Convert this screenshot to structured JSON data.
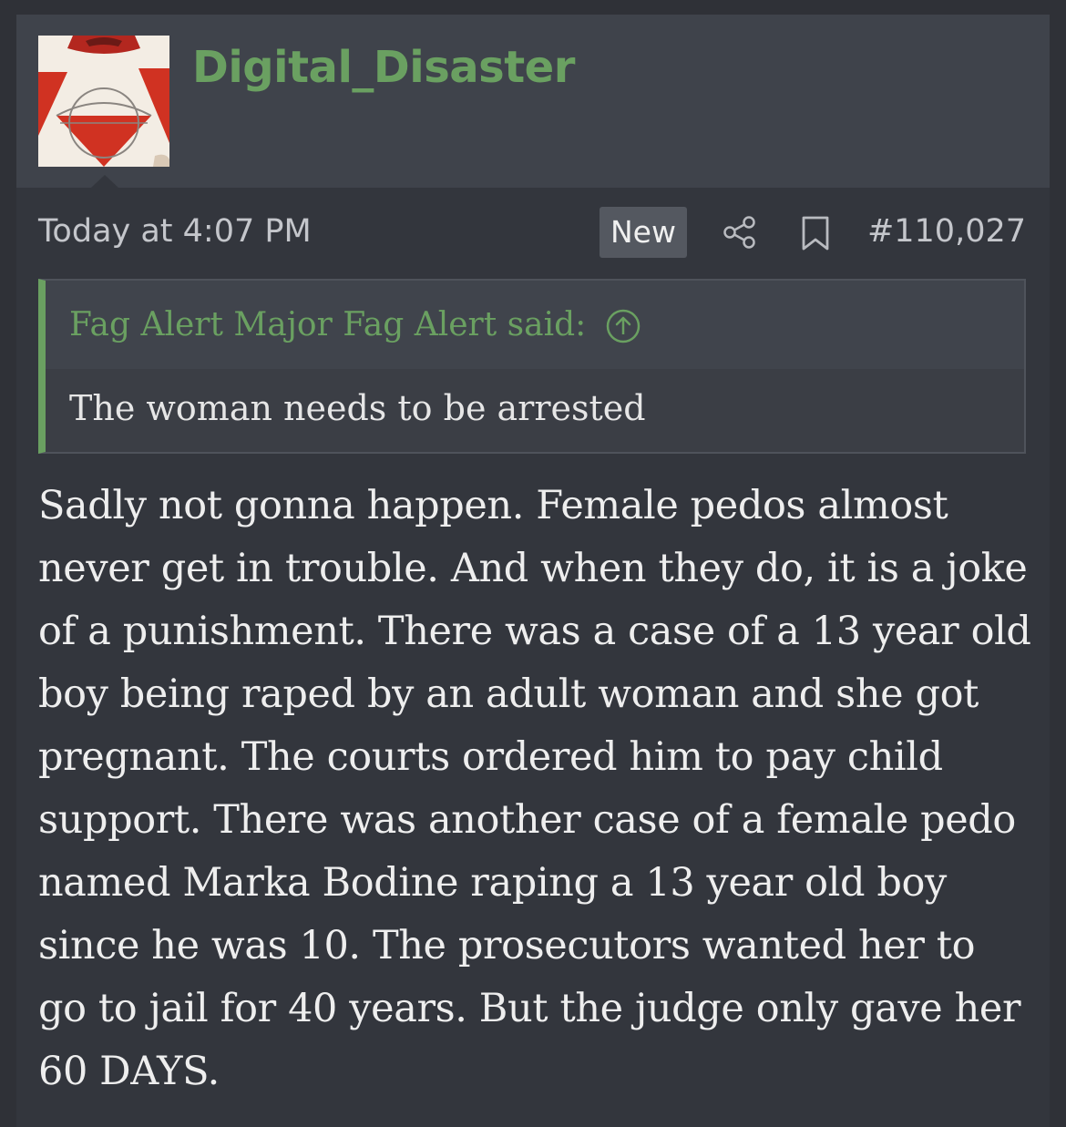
{
  "post": {
    "username": "Digital_Disaster",
    "timestamp": "Today at 4:07 PM",
    "badge": "New",
    "post_number": "#110,027",
    "icons": {
      "share": "share-icon",
      "bookmark": "bookmark-icon",
      "quote_jump": "arrow-up-circle-icon"
    },
    "colors": {
      "username": "#6aa061",
      "quote_accent": "#6aa061"
    }
  },
  "quote": {
    "author": "Fag Alert Major Fag Alert said:",
    "text": "The woman needs to be arrested"
  },
  "message": {
    "text": "Sadly not gonna happen. Female pedos almost never get in trouble. And when they do, it is a joke of a punishment. There was a case of a 13 year old boy being raped by an adult woman and she got pregnant. The courts ordered him to pay child support. There was another case of a female pedo named Marka Bodine raping a 13 year old boy since he was 10. The prosecutors wanted her to go to jail for 40 years. But the judge only gave her 60 DAYS."
  }
}
